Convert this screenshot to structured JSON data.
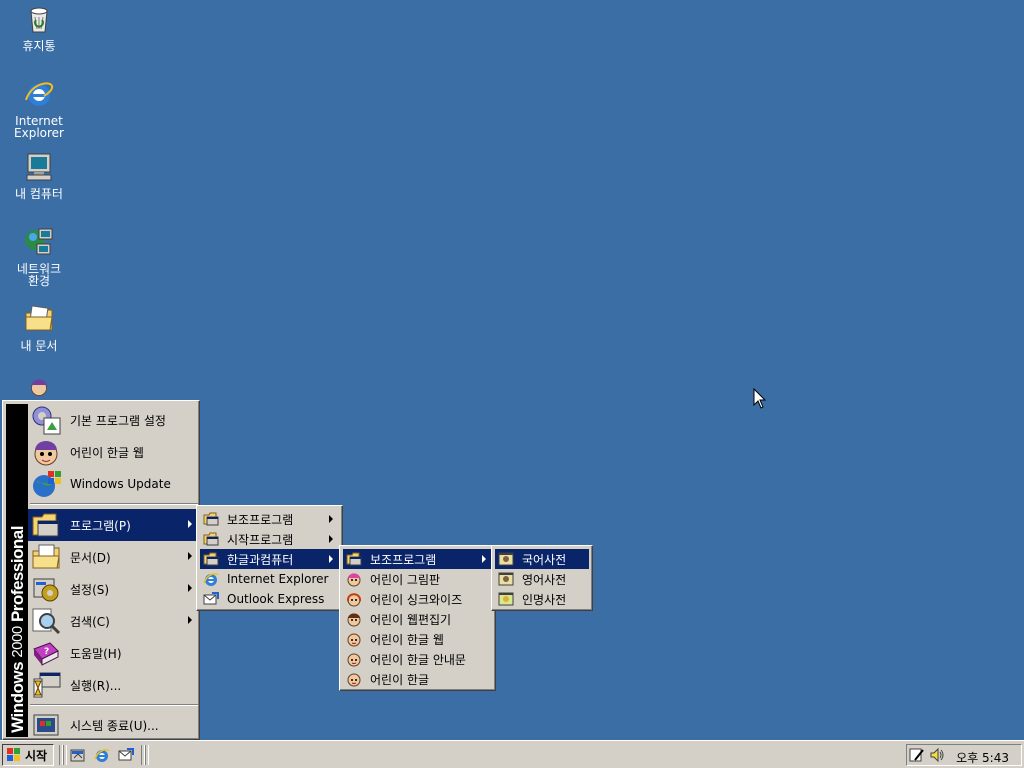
{
  "desktop": {
    "icons": [
      {
        "label": "휴지통",
        "icon": "recycle-bin-icon"
      },
      {
        "label": "Internet\nExplorer",
        "icon": "internet-explorer-icon"
      },
      {
        "label": "내 컴퓨터",
        "icon": "my-computer-icon"
      },
      {
        "label": "네트워크\n환경",
        "icon": "network-icon"
      },
      {
        "label": "내 문서",
        "icon": "my-documents-icon"
      }
    ]
  },
  "start_menu": {
    "banner": {
      "os": "Windows",
      "version": "2000",
      "edition": "Professional"
    },
    "top_items": [
      {
        "label": "기본 프로그램 설정"
      },
      {
        "label": "어린이 한글 웹"
      },
      {
        "label": "Windows Update"
      }
    ],
    "items": [
      {
        "label": "프로그램(P)",
        "has_submenu": true,
        "selected": true
      },
      {
        "label": "문서(D)",
        "has_submenu": true
      },
      {
        "label": "설정(S)",
        "has_submenu": true
      },
      {
        "label": "검색(C)",
        "has_submenu": true
      },
      {
        "label": "도움말(H)"
      },
      {
        "label": "실행(R)..."
      }
    ],
    "shutdown": {
      "label": "시스템 종료(U)..."
    }
  },
  "programs_menu": {
    "items": [
      {
        "label": "보조프로그램",
        "has_submenu": true
      },
      {
        "label": "시작프로그램",
        "has_submenu": true
      },
      {
        "label": "한글과컴퓨터",
        "has_submenu": true,
        "selected": true
      },
      {
        "label": "Internet Explorer"
      },
      {
        "label": "Outlook Express"
      }
    ]
  },
  "hancom_menu": {
    "items": [
      {
        "label": "보조프로그램",
        "has_submenu": true,
        "selected": true
      },
      {
        "label": "어린이 그림판"
      },
      {
        "label": "어린이 싱크와이즈"
      },
      {
        "label": "어린이 웹편집기"
      },
      {
        "label": "어린이 한글 웹"
      },
      {
        "label": "어린이 한글 안내문"
      },
      {
        "label": "어린이 한글"
      }
    ]
  },
  "accessories_menu": {
    "items": [
      {
        "label": "국어사전",
        "selected": true
      },
      {
        "label": "영어사전"
      },
      {
        "label": "인명사전"
      }
    ]
  },
  "taskbar": {
    "start_label": "시작",
    "clock": "오후 5:43",
    "quick_launch": [
      "show-desktop-icon",
      "internet-explorer-icon",
      "outlook-express-icon"
    ],
    "tray": [
      "ime-pen-icon",
      "volume-icon"
    ]
  },
  "colors": {
    "desktop": "#3a6ea5",
    "face": "#d4d0c8",
    "highlight": "#0a246a"
  }
}
